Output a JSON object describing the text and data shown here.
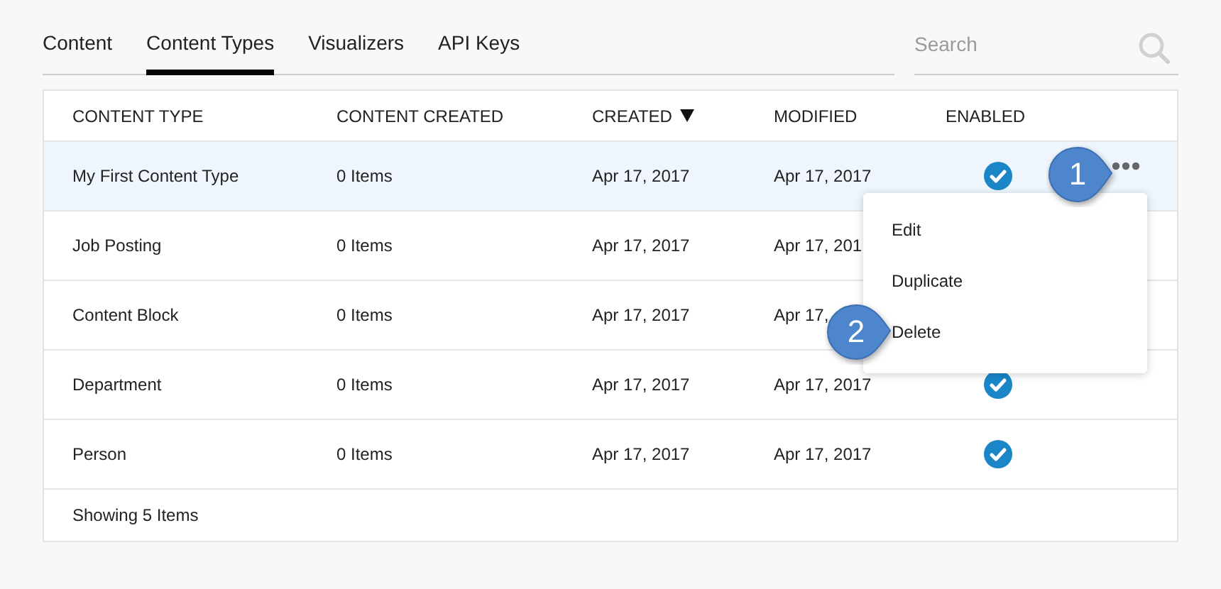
{
  "tabs": [
    {
      "label": "Content",
      "selected": false
    },
    {
      "label": "Content Types",
      "selected": true
    },
    {
      "label": "Visualizers",
      "selected": false
    },
    {
      "label": "API Keys",
      "selected": false
    }
  ],
  "search": {
    "placeholder": "Search"
  },
  "table": {
    "columns": [
      {
        "label": "CONTENT TYPE"
      },
      {
        "label": "CONTENT CREATED"
      },
      {
        "label": "CREATED",
        "sorted_descending": true
      },
      {
        "label": "MODIFIED"
      },
      {
        "label": "ENABLED"
      }
    ],
    "rows": [
      {
        "name": "My First Content Type",
        "count": "0 Items",
        "created": "Apr 17, 2017",
        "modified": "Apr 17, 2017",
        "enabled": true,
        "selected": true,
        "menu_open": true
      },
      {
        "name": "Job Posting",
        "count": "0 Items",
        "created": "Apr 17, 2017",
        "modified": "Apr 17, 201",
        "selected": false,
        "menu_open": false
      },
      {
        "name": "Content Block",
        "count": "0 Items",
        "created": "Apr 17, 2017",
        "modified": "Apr 17,",
        "selected": false,
        "menu_open": false
      },
      {
        "name": "Department",
        "count": "0 Items",
        "created": "Apr 17, 2017",
        "modified": "Apr 17, 2017",
        "enabled": true,
        "selected": false,
        "menu_open": false
      },
      {
        "name": "Person",
        "count": "0 Items",
        "created": "Apr 17, 2017",
        "modified": "Apr 17, 2017",
        "enabled": true,
        "selected": false,
        "menu_open": false
      }
    ],
    "footer": "Showing 5 Items"
  },
  "menu": {
    "items": [
      "Edit",
      "Duplicate",
      "Delete"
    ]
  },
  "callouts": [
    {
      "label": "1"
    },
    {
      "label": "2"
    }
  ]
}
